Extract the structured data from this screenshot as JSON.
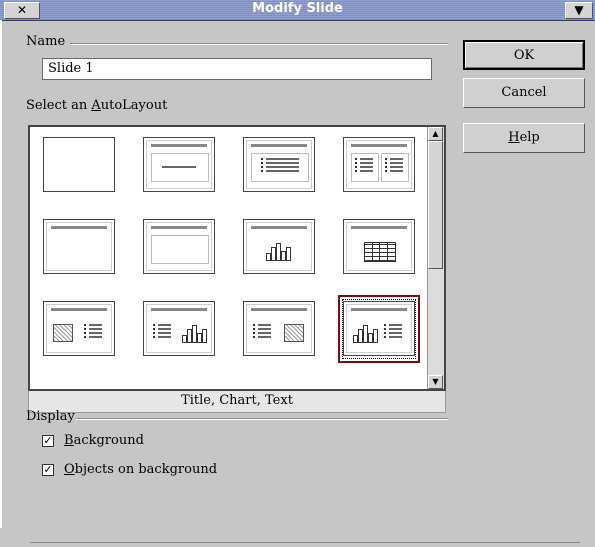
{
  "window": {
    "title": "Modify Slide",
    "close_glyph": "✕",
    "menu_glyph": "▼"
  },
  "name_group": {
    "label": "Name",
    "value": "Slide 1"
  },
  "layout_group": {
    "label": "Select an AutoLayout",
    "label_underline_char": "A",
    "selected_caption": "Title, Chart, Text",
    "layouts": [
      {
        "name": "Blank Slide",
        "kind": "blank"
      },
      {
        "name": "Title Slide",
        "kind": "title-subtitle"
      },
      {
        "name": "Title, Text",
        "kind": "title-list"
      },
      {
        "name": "Title, 2 Text",
        "kind": "title-2list"
      },
      {
        "name": "Title Only",
        "kind": "title-only"
      },
      {
        "name": "Centered Text",
        "kind": "title-box"
      },
      {
        "name": "Title, Chart",
        "kind": "title-chart"
      },
      {
        "name": "Title, Spreadsheet",
        "kind": "title-table"
      },
      {
        "name": "Title, Clipart, Text",
        "kind": "title-clip-text"
      },
      {
        "name": "Title, Text, Chart",
        "kind": "title-text-chart"
      },
      {
        "name": "Title, Text, Clipart",
        "kind": "title-text-clip"
      },
      {
        "name": "Title, Chart, Text",
        "kind": "title-chart-text",
        "selected": true
      }
    ]
  },
  "display_group": {
    "label": "Display",
    "background": {
      "label": "Background",
      "checked": true
    },
    "objects_on_background": {
      "label": "Objects on background",
      "checked": true
    }
  },
  "buttons": {
    "ok": "OK",
    "cancel": "Cancel",
    "help": "Help"
  }
}
